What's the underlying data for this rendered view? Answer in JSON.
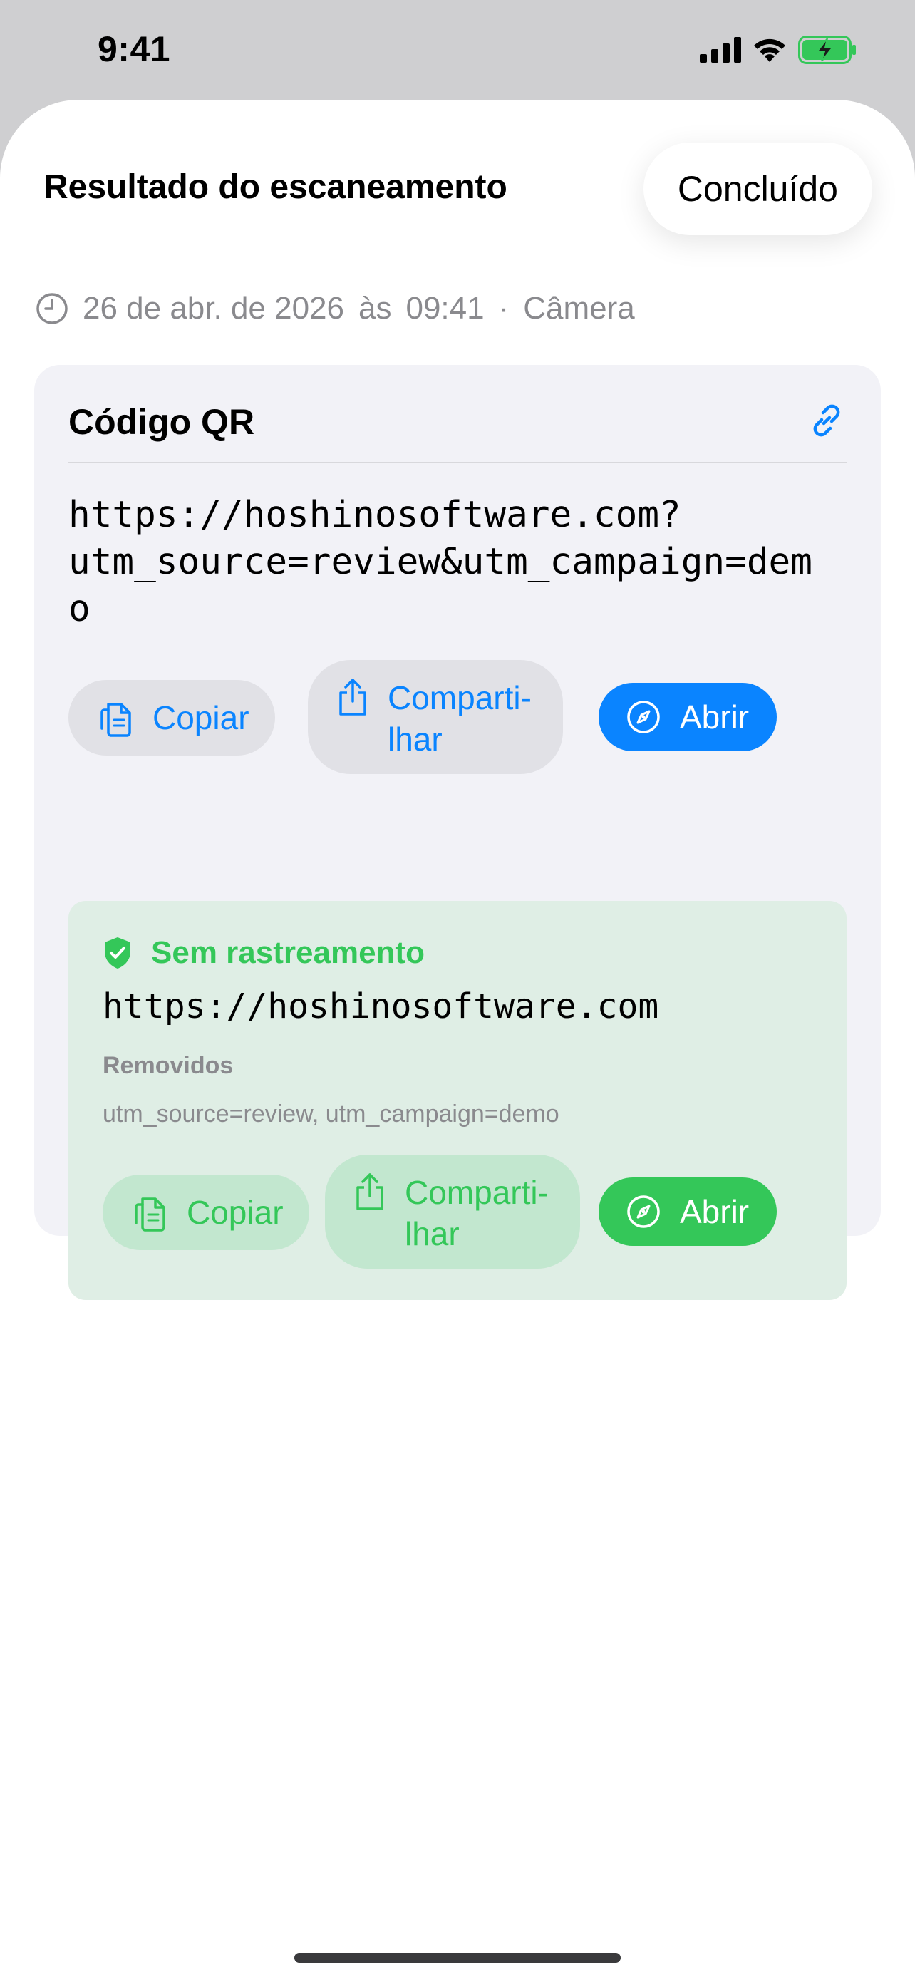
{
  "status": {
    "time": "9:41"
  },
  "sheet": {
    "title": "Resultado do escaneamento",
    "done_label": "Concluído"
  },
  "meta": {
    "date": "26 de abr. de 2026",
    "at": "às",
    "time": "09:41",
    "separator": "·",
    "source": "Câmera"
  },
  "card": {
    "title": "Código QR",
    "url": "https://hoshinosoftware.com?\nutm_source=review&utm_campaign=dem\no",
    "actions": {
      "copy": "Copiar",
      "share": "Comparti-\nlhar",
      "open": "Abrir"
    }
  },
  "clean": {
    "title": "Sem rastreamento",
    "url": "https://hoshinosoftware.com",
    "removed_label": "Removidos",
    "removed_value": "utm_source=review, utm_campaign=demo",
    "actions": {
      "copy": "Copiar",
      "share": "Comparti-\nlhar",
      "open": "Abrir"
    }
  },
  "colors": {
    "accent": "#0a84ff",
    "success": "#34c759",
    "card_bg": "#f2f2f7",
    "clean_bg": "#dfeee5"
  }
}
